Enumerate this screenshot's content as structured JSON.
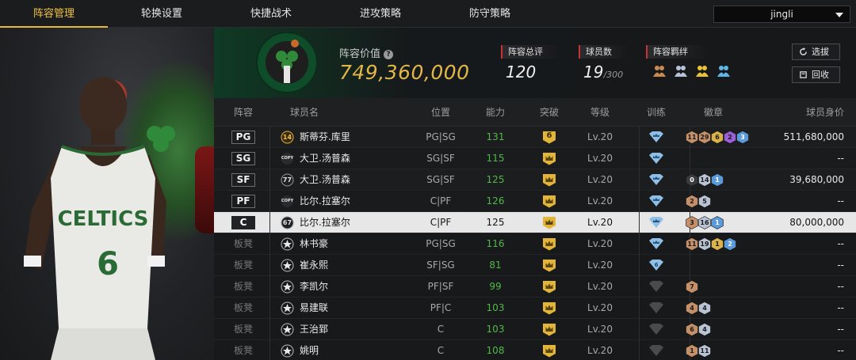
{
  "nav": {
    "tabs": [
      "阵容管理",
      "轮换设置",
      "快捷战术",
      "进攻策略",
      "防守策略"
    ],
    "active_index": 0,
    "user_select": "jingli"
  },
  "header": {
    "value_label": "阵容价值",
    "value": "749,360,000",
    "stats": {
      "overall_label": "阵容总评",
      "overall_value": "120",
      "count_label": "球员数",
      "count_value": "19",
      "count_max": "/300",
      "bond_label": "阵容羁绊"
    },
    "buttons": {
      "select": "选拔",
      "recall": "回收"
    }
  },
  "colors": {
    "accent": "#e8b83a",
    "value_gold": "#e3b64a",
    "ability_green": "#52b848",
    "label_red": "#c83232"
  },
  "table": {
    "headers": [
      "阵容",
      "球员名",
      "位置",
      "能力",
      "突破",
      "等级",
      "训练",
      "徽章",
      "球员身价"
    ],
    "rows": [
      {
        "slot": "PG",
        "bench": false,
        "selected": false,
        "num": "14",
        "num_style": "gold",
        "name": "斯蒂芬.库里",
        "pos": "PG|SG",
        "ability": "131",
        "breakthrough": "6",
        "level": "Lv.20",
        "training": "blue",
        "badges": [
          [
            "bronze",
            "11"
          ],
          [
            "bronze",
            "29"
          ],
          [
            "gold",
            "6"
          ],
          [
            "hof",
            "2"
          ],
          [
            "blue",
            "3"
          ]
        ],
        "value": "511,680,000"
      },
      {
        "slot": "SG",
        "bench": false,
        "selected": false,
        "num": "COPY",
        "num_style": "copy",
        "name": "大卫.汤普森",
        "pos": "SG|SF",
        "ability": "115",
        "breakthrough": "",
        "level": "Lv.20",
        "training": "blue",
        "badges": [],
        "value": "--"
      },
      {
        "slot": "SF",
        "bench": false,
        "selected": false,
        "num": "77",
        "num_style": "dark",
        "name": "大卫.汤普森",
        "pos": "SG|SF",
        "ability": "125",
        "breakthrough": "",
        "level": "Lv.20",
        "training": "blue",
        "badges": [
          [
            "dark",
            "0"
          ],
          [
            "silver",
            "14"
          ],
          [
            "blue",
            "1"
          ]
        ],
        "value": "39,680,000"
      },
      {
        "slot": "PF",
        "bench": false,
        "selected": false,
        "num": "COPY",
        "num_style": "copy",
        "name": "比尔.拉塞尔",
        "pos": "C|PF",
        "ability": "126",
        "breakthrough": "",
        "level": "Lv.20",
        "training": "blue",
        "badges": [
          [
            "bronze",
            "2"
          ],
          [
            "silver",
            "5"
          ]
        ],
        "value": "--"
      },
      {
        "slot": "C",
        "bench": false,
        "selected": true,
        "num": "67",
        "num_style": "dark",
        "name": "比尔.拉塞尔",
        "pos": "C|PF",
        "ability": "125",
        "breakthrough": "",
        "level": "Lv.20",
        "training": "blue",
        "badges": [
          [
            "bronze",
            "3"
          ],
          [
            "silver",
            "16"
          ],
          [
            "blue",
            "1"
          ]
        ],
        "value": "80,000,000"
      },
      {
        "slot": "板凳",
        "bench": true,
        "selected": false,
        "num": "",
        "num_style": "star",
        "name": "林书豪",
        "pos": "PG|SG",
        "ability": "116",
        "breakthrough": "",
        "level": "Lv.20",
        "training": "blue",
        "badges": [
          [
            "bronze",
            "11"
          ],
          [
            "silver",
            "19"
          ],
          [
            "gold",
            "1"
          ],
          [
            "blue",
            "2"
          ]
        ],
        "value": "--"
      },
      {
        "slot": "板凳",
        "bench": true,
        "selected": false,
        "num": "",
        "num_style": "star",
        "name": "崔永熙",
        "pos": "SF|SG",
        "ability": "81",
        "breakthrough": "",
        "level": "Lv.20",
        "training": "blue6",
        "badges": [],
        "value": "--"
      },
      {
        "slot": "板凳",
        "bench": true,
        "selected": false,
        "num": "",
        "num_style": "star",
        "name": "李凯尔",
        "pos": "PF|SF",
        "ability": "99",
        "breakthrough": "",
        "level": "Lv.20",
        "training": "gray",
        "badges": [
          [
            "bronze",
            "7"
          ]
        ],
        "value": "--"
      },
      {
        "slot": "板凳",
        "bench": true,
        "selected": false,
        "num": "",
        "num_style": "star",
        "name": "易建联",
        "pos": "PF|C",
        "ability": "103",
        "breakthrough": "",
        "level": "Lv.20",
        "training": "gray",
        "badges": [
          [
            "bronze",
            "4"
          ],
          [
            "silver",
            "4"
          ]
        ],
        "value": "--"
      },
      {
        "slot": "板凳",
        "bench": true,
        "selected": false,
        "num": "",
        "num_style": "star",
        "name": "王治郅",
        "pos": "C",
        "ability": "103",
        "breakthrough": "",
        "level": "Lv.20",
        "training": "gray",
        "badges": [
          [
            "bronze",
            "6"
          ],
          [
            "silver",
            "4"
          ]
        ],
        "value": "--"
      },
      {
        "slot": "板凳",
        "bench": true,
        "selected": false,
        "num": "",
        "num_style": "star",
        "name": "姚明",
        "pos": "C",
        "ability": "108",
        "breakthrough": "",
        "level": "Lv.20",
        "training": "gray",
        "badges": [
          [
            "bronze",
            "1"
          ],
          [
            "silver",
            "11"
          ]
        ],
        "value": "--"
      }
    ]
  }
}
